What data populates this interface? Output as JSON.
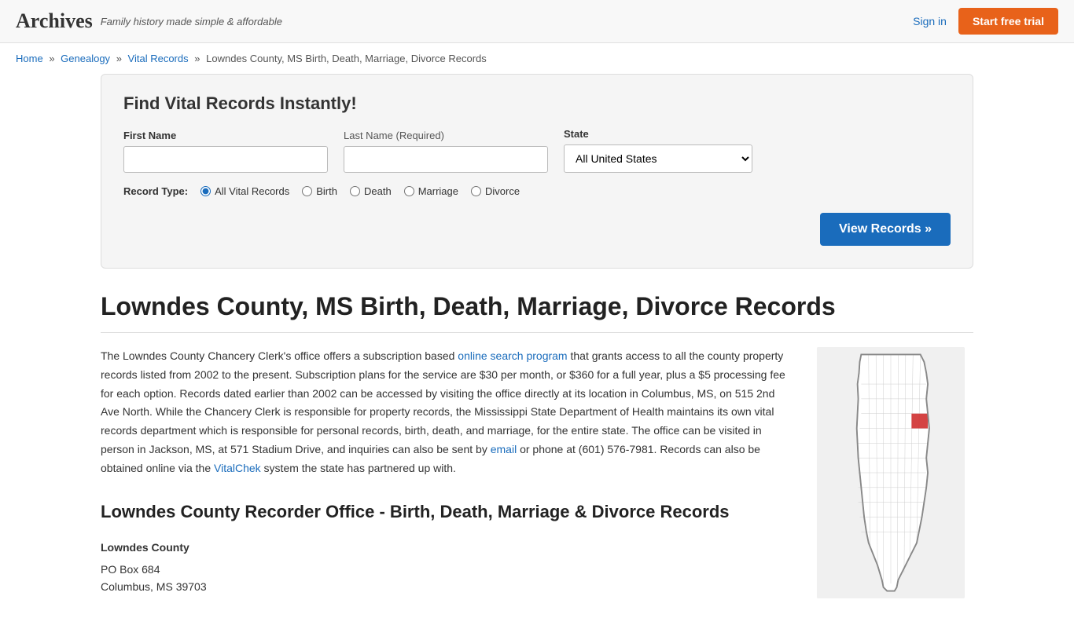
{
  "header": {
    "logo": "Archives",
    "tagline": "Family history made simple & affordable",
    "sign_in": "Sign in",
    "start_trial": "Start free trial"
  },
  "breadcrumb": {
    "home": "Home",
    "genealogy": "Genealogy",
    "vital_records": "Vital Records",
    "current": "Lowndes County, MS Birth, Death, Marriage, Divorce Records"
  },
  "search": {
    "title": "Find Vital Records Instantly!",
    "first_name_label": "First Name",
    "last_name_label": "Last Name",
    "last_name_required": "(Required)",
    "state_label": "State",
    "state_value": "All United States",
    "record_type_label": "Record Type:",
    "record_types": [
      {
        "id": "all",
        "label": "All Vital Records",
        "checked": true
      },
      {
        "id": "birth",
        "label": "Birth",
        "checked": false
      },
      {
        "id": "death",
        "label": "Death",
        "checked": false
      },
      {
        "id": "marriage",
        "label": "Marriage",
        "checked": false
      },
      {
        "id": "divorce",
        "label": "Divorce",
        "checked": false
      }
    ],
    "view_records_btn": "View Records »"
  },
  "page": {
    "title": "Lowndes County, MS Birth, Death, Marriage, Divorce Records",
    "body_text": "The Lowndes County Chancery Clerk's office offers a subscription based ",
    "link1_text": "online search program",
    "body_text2": " that grants access to all the county property records listed from 2002 to the present. Subscription plans for the service are $30 per month, or $360 for a full year, plus a $5 processing fee for each option. Records dated earlier than 2002 can be accessed by visiting the office directly at its location in Columbus, MS, on 515 2nd Ave North. While the Chancery Clerk is responsible for property records, the Mississippi State Department of Health maintains its own vital records department which is responsible for personal records, birth, death, and marriage, for the entire state. The office can be visited in person in Jackson, MS, at 571 Stadium Drive, and inquiries can also be sent by ",
    "link2_text": "email",
    "body_text3": " or phone at (601) 576-7981. Records can also be obtained online via the ",
    "link3_text": "VitalChek",
    "body_text4": " system the state has partnered up with.",
    "section2_title": "Lowndes County Recorder Office - Birth, Death, Marriage & Divorce Records",
    "office_name": "Lowndes County",
    "office_address_line1": "PO Box 684",
    "office_address_line2": "Columbus, MS 39703"
  }
}
